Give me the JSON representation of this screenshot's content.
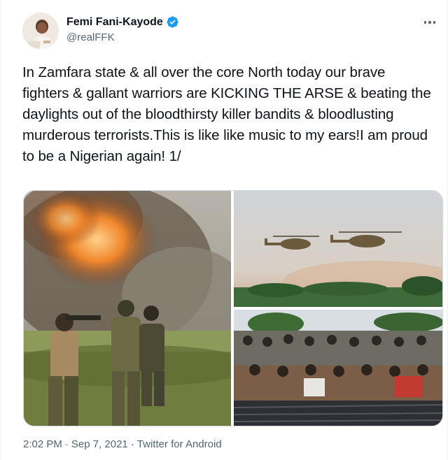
{
  "author": {
    "display_name": "Femi Fani-Kayode",
    "handle": "@realFFK",
    "verified_icon": "verified-badge-icon",
    "avatar_icon": "profile-photo"
  },
  "tweet": {
    "text": "In Zamfara state & all over the core North today our brave fighters & gallant warriors are KICKING THE ARSE & beating the daylights out of the bloodthirsty killer bandits & bloodlusting murderous terrorists.This is like like music to my ears!I am proud to be a Nigerian again! 1/",
    "time": "2:02 PM",
    "separator1": "·",
    "date": "Sep 7, 2021",
    "separator2": "·",
    "source": "Twitter for Android"
  },
  "media": {
    "left_photo": "soldiers-explosion-photo",
    "top_right_photo": "helicopters-photo",
    "bottom_right_photo": "detainees-photo"
  },
  "colors": {
    "accent": "#1d9bf0",
    "text_primary": "#0f1419",
    "text_secondary": "#536471",
    "border": "#cfd9de"
  }
}
